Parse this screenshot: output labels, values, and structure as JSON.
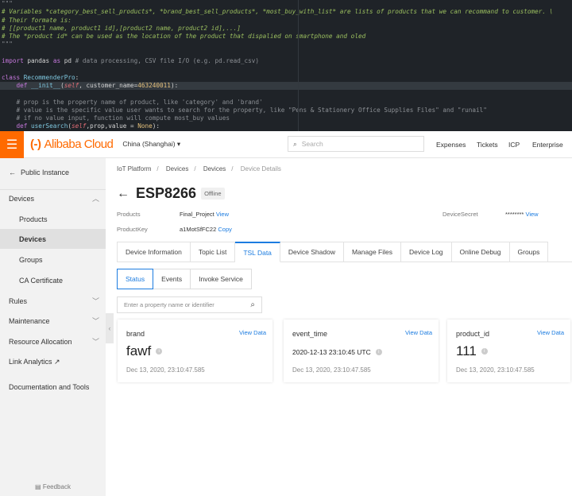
{
  "code_editor": {
    "lines": [
      {
        "parts": [
          {
            "t": "\"\"\"",
            "c": "gr"
          }
        ]
      },
      {
        "parts": [
          {
            "t": "# Variables *category_best_sell_products*, *brand_best_sell_products*, *most_buy_with_list* are lists of products that we can recommand to customer. \\",
            "c": "cm"
          }
        ]
      },
      {
        "parts": [
          {
            "t": "# Their formate is:",
            "c": "cm"
          }
        ]
      },
      {
        "parts": [
          {
            "t": "# [[product1 name, product1 id],[product2 name, product2 id],...]",
            "c": "cm"
          }
        ]
      },
      {
        "parts": [
          {
            "t": "# The *product id* can be used as the location of the product that dispalied on smartphone and oled",
            "c": "cm"
          }
        ]
      },
      {
        "parts": [
          {
            "t": "\"\"\"",
            "c": "gr"
          }
        ]
      },
      {
        "parts": []
      },
      {
        "parts": [
          {
            "t": "import",
            "c": "kw"
          },
          {
            "t": " pandas ",
            "c": ""
          },
          {
            "t": "as",
            "c": "kw"
          },
          {
            "t": " pd ",
            "c": ""
          },
          {
            "t": "# data processing, CSV file I/O (e.g. pd.read_csv)",
            "c": "gr"
          }
        ]
      },
      {
        "parts": []
      },
      {
        "parts": [
          {
            "t": "class",
            "c": "kw"
          },
          {
            "t": " RecommenderPro",
            "c": "cl"
          },
          {
            "t": ":",
            "c": ""
          }
        ]
      },
      {
        "hl": true,
        "parts": [
          {
            "t": "    def",
            "c": "kw"
          },
          {
            "t": " __init__",
            "c": "cl"
          },
          {
            "t": "(",
            "c": ""
          },
          {
            "t": "self",
            "c": "sf"
          },
          {
            "t": ", customer_name=",
            "c": ""
          },
          {
            "t": "463240011",
            "c": "nm"
          },
          {
            "t": "):",
            "c": ""
          }
        ]
      },
      {
        "parts": []
      },
      {
        "parts": [
          {
            "t": "    # prop is the property name of product, like 'category' and 'brand'",
            "c": "gr"
          }
        ]
      },
      {
        "parts": [
          {
            "t": "    # value is the specific value user wants to search for the property, like \"Pens & Stationery Office Supplies Files\" and \"runail\"",
            "c": "gr"
          }
        ]
      },
      {
        "parts": [
          {
            "t": "    # if no value input, function will compute most_buy values",
            "c": "gr"
          }
        ]
      },
      {
        "parts": [
          {
            "t": "    def",
            "c": "kw"
          },
          {
            "t": " userSearch",
            "c": "cl"
          },
          {
            "t": "(",
            "c": ""
          },
          {
            "t": "self",
            "c": "sf"
          },
          {
            "t": ",prop,value = ",
            "c": ""
          },
          {
            "t": "None",
            "c": "nm"
          },
          {
            "t": "):",
            "c": ""
          }
        ]
      }
    ]
  },
  "topbar": {
    "menu_icon": "hamburger-icon",
    "logo_mark": "(-)",
    "logo_text": "Alibaba Cloud",
    "region": "China (Shanghai) ▾",
    "search_placeholder": "Search",
    "links": [
      "Expenses",
      "Tickets",
      "ICP",
      "Enterprise"
    ],
    "brand_color": "#ff6a00"
  },
  "sidebar": {
    "back": "Public Instance",
    "items": [
      {
        "label": "Devices",
        "chev": "^"
      },
      {
        "label": "Products",
        "sub": true
      },
      {
        "label": "Devices",
        "sub": true,
        "selected": true
      },
      {
        "label": "Groups",
        "sub": true
      },
      {
        "label": "CA Certificate",
        "sub": true
      },
      {
        "label": "Rules",
        "chev": "v"
      },
      {
        "label": "Maintenance",
        "chev": "v"
      },
      {
        "label": "Resource Allocation",
        "chev": "v"
      },
      {
        "label": "Link Analytics ↗"
      },
      {
        "label": "Documentation and Tools"
      }
    ],
    "feedback": "Feedback"
  },
  "main": {
    "breadcrumb": [
      "IoT Platform",
      "Devices",
      "Devices",
      "Device Details"
    ],
    "title": "ESP8266",
    "status": "Offline",
    "products_label": "Products",
    "products_value": "Final_Project",
    "products_link": "View",
    "productkey_label": "ProductKey",
    "productkey_value": "a1MotSfFC22",
    "productkey_link": "Copy",
    "secret_label": "DeviceSecret",
    "secret_value": "********",
    "secret_link": "View",
    "tabs": [
      "Device Information",
      "Topic List",
      "TSL Data",
      "Device Shadow",
      "Manage Files",
      "Device Log",
      "Online Debug",
      "Groups"
    ],
    "active_tab": "TSL Data",
    "subtabs": [
      "Status",
      "Events",
      "Invoke Service"
    ],
    "property_search_placeholder": "Enter a property name or identifier",
    "cards": [
      {
        "name": "brand",
        "link": "View Data",
        "value": "fawf",
        "time": "Dec 13, 2020, 23:10:47.585"
      },
      {
        "name": "event_time",
        "link": "View Data",
        "value": "2020-12-13 23:10:45 UTC",
        "time": "Dec 13, 2020, 23:10:47.585"
      },
      {
        "name": "product_id",
        "link": "View Data",
        "value": "111",
        "time": "Dec 13, 2020, 23:10:47.585"
      }
    ]
  }
}
